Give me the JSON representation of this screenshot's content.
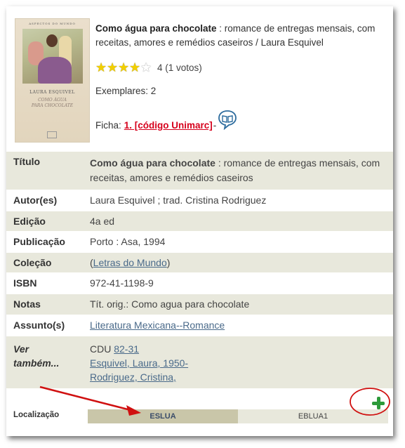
{
  "record": {
    "title_bold": "Como água para chocolate",
    "title_rest": " : romance de entregas mensais, com receitas, amores e remédios caseiros / Laura Esquivel",
    "rating": {
      "stars": 4,
      "max": 5,
      "text": "4 (1 votos)"
    },
    "copies": "Exemplares: 2",
    "ficha_label": "Ficha:",
    "ficha_link": "1. [código Unimarc]",
    "ficha_dash": "-",
    "cover": {
      "top_text": "ASPECTOS DO MUNDO",
      "author": "LAURA ESQUIVEL",
      "title_line1": "COMO ÁGUA",
      "title_line2": "PARA CHOCOLATE"
    }
  },
  "details": {
    "titulo": {
      "label": "Título",
      "value_bold": "Como água para chocolate",
      "value_rest": " : romance de entregas mensais, com receitas, amores e remédios caseiros"
    },
    "autores": {
      "label": "Autor(es)",
      "value": "Laura Esquivel ; trad. Cristina Rodriguez"
    },
    "edicao": {
      "label": "Edição",
      "value": "4a ed"
    },
    "publicacao": {
      "label": "Publicação",
      "value": "Porto : Asa, 1994"
    },
    "colecao": {
      "label": "Coleção",
      "open": "(",
      "link": "Letras do Mundo",
      "close": ")"
    },
    "isbn": {
      "label": "ISBN",
      "value": "972-41-1198-9"
    },
    "notas": {
      "label": "Notas",
      "value": "Tít. orig.: Como agua para chocolate"
    },
    "assunto": {
      "label": "Assunto(s)",
      "link": "Literatura Mexicana--Romance"
    },
    "ver_tambem": {
      "label_line1": "Ver",
      "label_line2": "também...",
      "cdu_label": "CDU ",
      "cdu_link": "82-31",
      "link1": "Esquivel, Laura, 1950-",
      "link2": "Rodriguez, Cristina,"
    }
  },
  "location": {
    "label": "Localização",
    "tabs": [
      "ESLUA",
      "EBLUA1"
    ]
  },
  "colors": {
    "alt_row": "#e8e8dc",
    "active_tab": "#c9c6a9",
    "link": "#4a6a8a",
    "ficha_link": "#d6001c",
    "plus": "#2d9a3a",
    "annotation": "#d01010"
  },
  "icons": [
    "star-icon",
    "book-info-icon",
    "plus-icon"
  ]
}
